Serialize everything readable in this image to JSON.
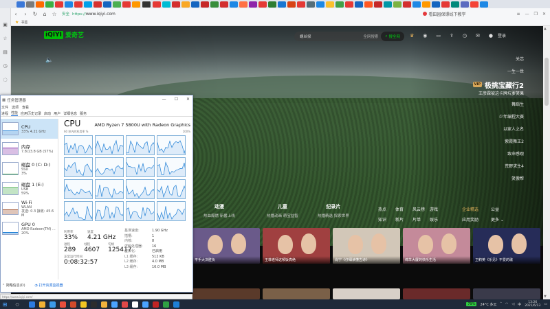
{
  "browser": {
    "tab_favicons": [
      "#3a78d8",
      "#7b7b7b",
      "#ff6a00",
      "#3cb043",
      "#e53935",
      "#1e88e5",
      "#e53935",
      "#00a0e9",
      "#d6322e",
      "#1565c0",
      "#4caf50",
      "#e53935",
      "#ff9800",
      "#333333",
      "#e53935",
      "#00bcd4",
      "#d32f2f",
      "#f9a825",
      "#1565c0",
      "#c62828",
      "#388e3c",
      "#d32f2f",
      "#1e88e5",
      "#ff7043",
      "#8e24aa",
      "#e53935",
      "#2e7d32",
      "#1976d2",
      "#d84315",
      "#e53935",
      "#546e7a",
      "#1e88e5",
      "#fbc02d",
      "#43a047",
      "#e53935",
      "#1565c0",
      "#ff5722",
      "#c62828",
      "#0097a7",
      "#7cb342",
      "#d32f2f",
      "#1e88e5",
      "#ff9800",
      "#1565c0",
      "#e53935",
      "#00897b",
      "#5c6bc0",
      "#f44336",
      "#1e88e5"
    ],
    "url_prefix": "安全",
    "url_scheme": "https://",
    "url_host": "www.iqiyi.com",
    "search_hint": "看田园保镖线下教学",
    "bookmarks_label": "书签"
  },
  "iqiyi": {
    "logo_badge": "iQIYI",
    "logo_text": "爱奇艺",
    "search_placeholder": "螺丝探",
    "search_all": "全网搜索",
    "search_button": "搜全网",
    "login": "登录",
    "right_list": [
      "关芯",
      "一生一世"
    ],
    "featured_vip": "VIP",
    "featured_title": "极挑宝藏行2",
    "featured_sub": "王彦霖被这卡牌坑爹笑果",
    "right_list2": [
      "舞蹈生",
      "少年编程大赛",
      "以家人之名",
      "紫霞舞王2",
      "致命感观",
      "荒野求生4",
      "笑傲帮"
    ],
    "categories": [
      {
        "title": "动漫",
        "subs": "热血爆燃  新番上线"
      },
      {
        "title": "儿童",
        "subs": "热播动画  萌宝益智"
      },
      {
        "title": "纪录片",
        "subs": "热播精选  探索世界"
      }
    ],
    "links": [
      "热点",
      "体育",
      "风云榜",
      "游戏",
      "知识",
      "新片",
      "片单",
      "娱乐"
    ],
    "links2": [
      "企业精选",
      "公益",
      "应用奖励",
      "更多 ⌄"
    ],
    "thumbs": [
      {
        "cap": "平手大决胜负",
        "bg": "#6a5a8a"
      },
      {
        "cap": "王菲老师这顿饭真绝",
        "bg": "#a04040"
      },
      {
        "cap": "肖宁《仔细读懂古诗》",
        "bg": "#d2c7b8"
      },
      {
        "cap": "绵羊大厦的快乐生活",
        "bg": "#c48a9a"
      },
      {
        "cap": "卫莉英《乐见》不爱的歌",
        "bg": "#262c58"
      }
    ]
  },
  "taskmgr": {
    "title": "任务管理器",
    "menu": [
      "文件",
      "选项",
      "查看"
    ],
    "tabs": [
      "进程",
      "性能",
      "应用历史记录",
      "启动",
      "用户",
      "详细信息",
      "服务"
    ],
    "resources": [
      {
        "name": "CPU",
        "sub": "33%  4.21 GHz",
        "color": "#1e7fd6",
        "fill": "0.33"
      },
      {
        "name": "内存",
        "sub": "7.8/13.8 GB (57%)",
        "color": "#8e3fae",
        "fill": "0.57"
      },
      {
        "name": "磁盘 0 (C: D:)",
        "sub1": "SSD",
        "sub2": "3%",
        "color": "#4caf50",
        "fill": "0.03"
      },
      {
        "name": "磁盘 1 (E:)",
        "sub1": "USB",
        "sub2": "59%",
        "color": "#4caf50",
        "fill": "0.59"
      },
      {
        "name": "Wi-Fi",
        "sub1": "WLAN",
        "sub2": "发送: 0.3  接收: 45.6 M",
        "color": "#a0522d",
        "fill": "0.4"
      },
      {
        "name": "GPU 0",
        "sub1": "AMD Radeon(TM) ...",
        "sub2": "20%",
        "color": "#1e7fd6",
        "fill": "0.2"
      }
    ],
    "cpu_label": "CPU",
    "cpu_model": "AMD Ryzen 7 5800U with Radeon Graphics",
    "graph_left": "60 秒内的利用率 %",
    "graph_right": "100%",
    "util_label": "利用率",
    "util": "33%",
    "speed_label": "速度",
    "speed": "4.21 GHz",
    "proc_label": "进程",
    "procs": "289",
    "threads_label": "线程",
    "threads": "4607",
    "handles_label": "句柄",
    "handles": "125417",
    "uptime_label": "正常运行时间",
    "uptime": "0:08:32:57",
    "specs": [
      {
        "k": "基准速度:",
        "v": "1.90 GHz"
      },
      {
        "k": "插槽:",
        "v": "1"
      },
      {
        "k": "内核:",
        "v": "8"
      },
      {
        "k": "逻辑处理器:",
        "v": "16"
      },
      {
        "k": "虚拟化:",
        "v": "已启用"
      },
      {
        "k": "L1 缓存:",
        "v": "512 KB"
      },
      {
        "k": "L2 缓存:",
        "v": "4.0 MB"
      },
      {
        "k": "L3 缓存:",
        "v": "16.0 MB"
      }
    ],
    "foot_less": "简略信息(D)",
    "foot_link": "打开资源监视器"
  },
  "taskbar": {
    "apps": [
      "#2d7be0",
      "#f2b134",
      "#3c9ae8",
      "#e94e3c",
      "#d04a2a",
      "#f3c623",
      "#2d2d2d",
      "#f0b13c",
      "#4aa3ff",
      "#e04848",
      "#ffffff",
      "#4aa3ff",
      "#c02525",
      "#2ea043",
      "#1e7fd6"
    ],
    "battery": "79%",
    "weather": "24°C  多云",
    "time": "13:26",
    "date": "2021/6/13"
  }
}
